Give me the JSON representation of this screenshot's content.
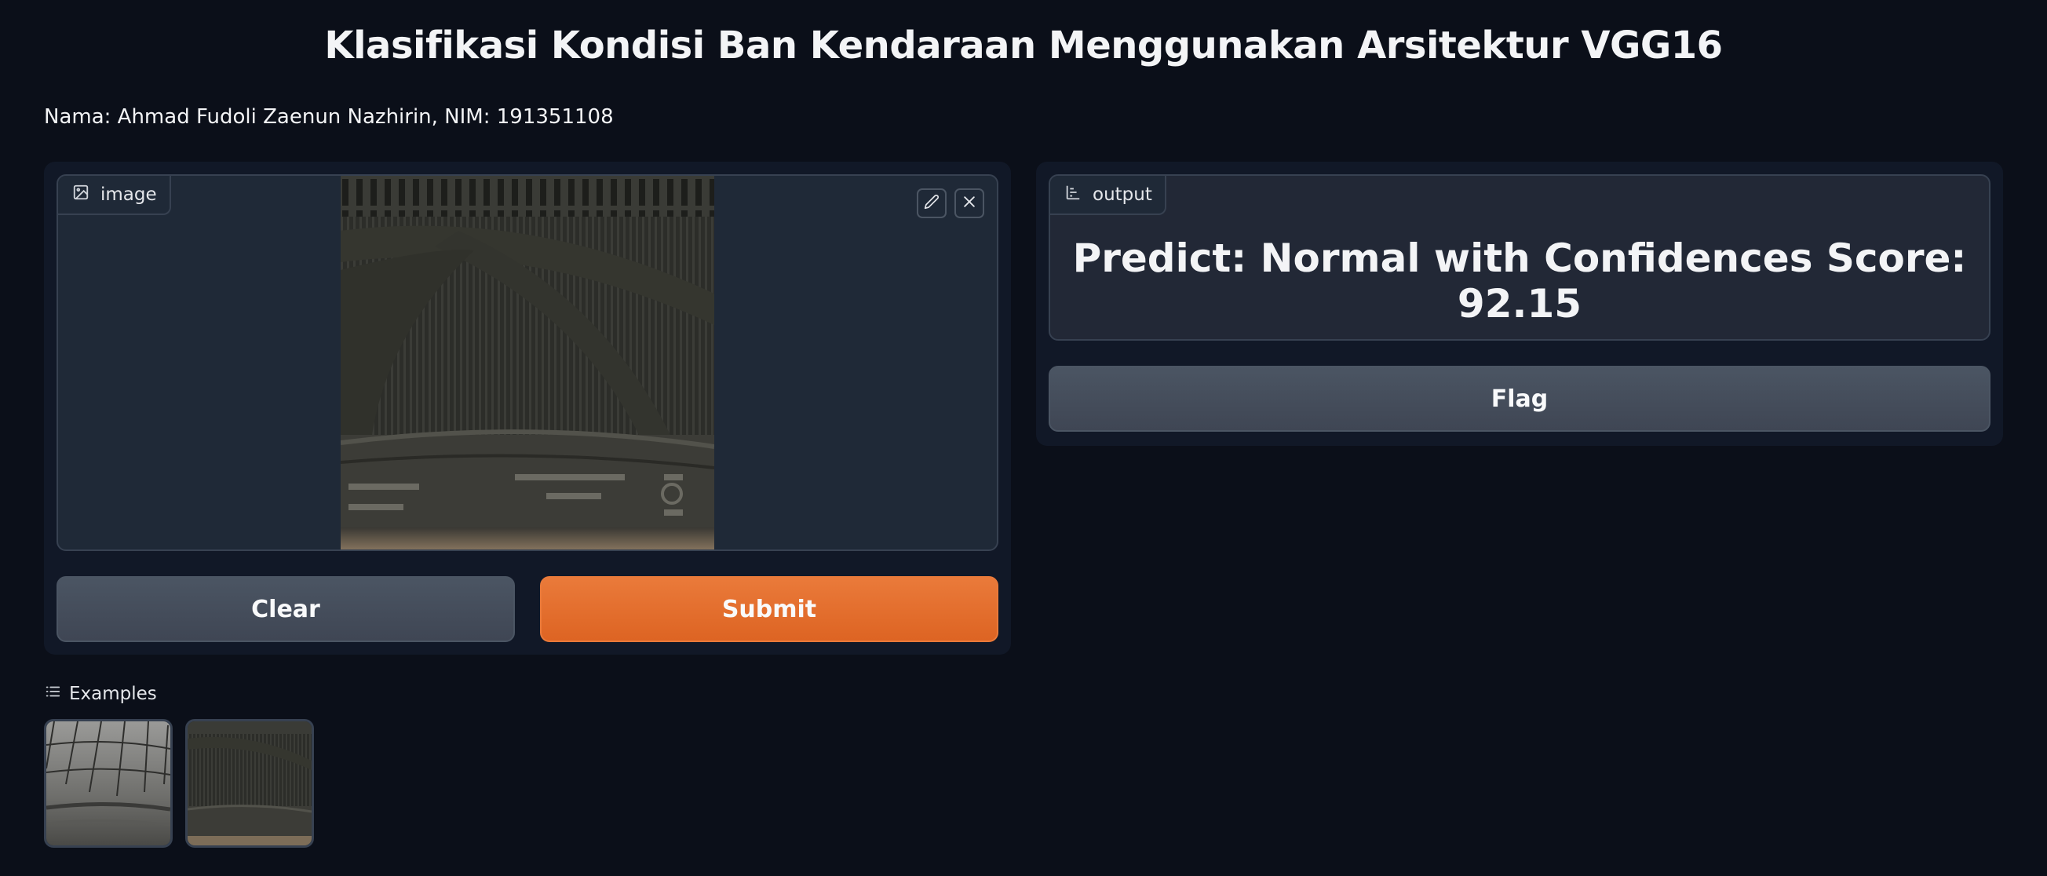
{
  "page": {
    "title": "Klasifikasi Kondisi Ban Kendaraan Menggunakan Arsitektur VGG16",
    "subtitle": "Nama: Ahmad Fudoli Zaenun Nazhirin, NIM: 191351108"
  },
  "input": {
    "label": "image",
    "icon": "image-icon",
    "tools": [
      "edit-icon",
      "close-icon"
    ],
    "clear_label": "Clear",
    "submit_label": "Submit"
  },
  "output": {
    "label": "output",
    "icon": "bar-chart-icon",
    "prediction": "Predict: Normal with Confidences Score: 92.15",
    "flag_label": "Flag"
  },
  "examples": {
    "label": "Examples",
    "icon": "list-icon",
    "count": 2
  },
  "colors": {
    "background": "#0b0f19",
    "panel": "#111827",
    "block": "#1f2937",
    "border": "#374151",
    "primary": "#e8712f",
    "secondary": "#4b5563"
  }
}
